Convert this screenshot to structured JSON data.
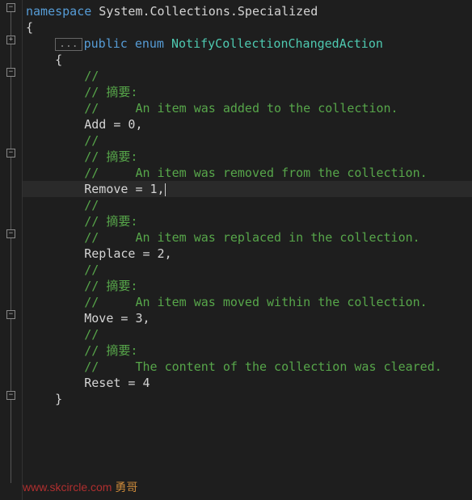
{
  "fold_collapsed_glyph": "+",
  "fold_expanded_glyph": "−",
  "code": {
    "ns_kw": "namespace",
    "ns_name": " System.Collections.Specialized",
    "brace_open": "{",
    "folded_placeholder": "...",
    "public_kw": "public",
    "enum_kw": " enum",
    "enum_name": " NotifyCollectionChangedAction",
    "inner_brace_open": "    {",
    "slashes": "        //",
    "summary_label": "        // 摘要:",
    "c_add": "        //     An item was added to the collection.",
    "m_add": "        Add = 0,",
    "c_remove": "        //     An item was removed from the collection.",
    "m_remove": "        Remove = 1,",
    "c_replace": "        //     An item was replaced in the collection.",
    "m_replace": "        Replace = 2,",
    "c_move": "        //     An item was moved within the collection.",
    "m_move": "        Move = 3,",
    "c_reset": "        //     The content of the collection was cleared.",
    "m_reset": "        Reset = 4",
    "inner_brace_close": "    }",
    "brace_close": "}"
  },
  "watermark": {
    "url": "www.skcircle.com ",
    "name": "勇哥"
  }
}
